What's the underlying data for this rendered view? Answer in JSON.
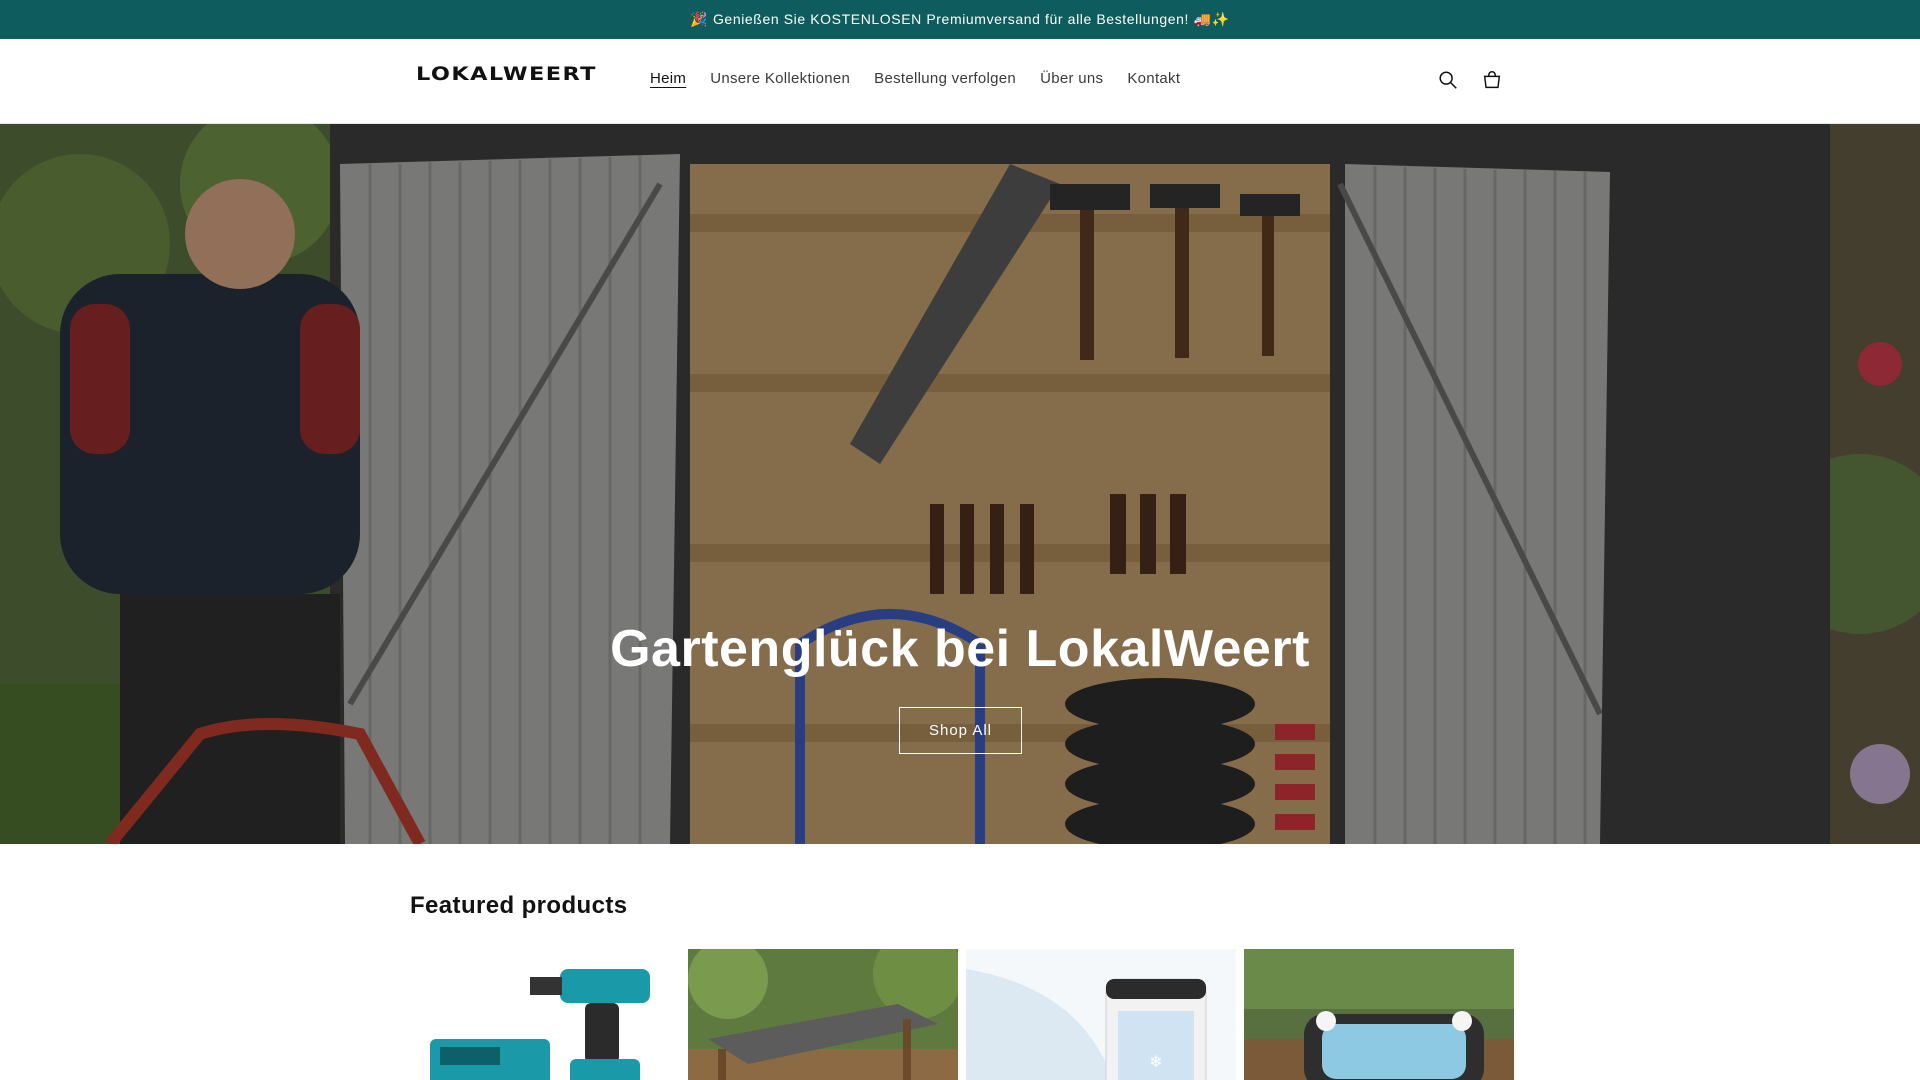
{
  "announcement": {
    "text": "🎉 Genießen Sie KOSTENLOSEN Premiumversand für alle Bestellungen! 🚚✨"
  },
  "header": {
    "logo": "LOKALWEERT",
    "nav": [
      {
        "label": "Heim",
        "active": true
      },
      {
        "label": "Unsere Kollektionen",
        "active": false
      },
      {
        "label": "Bestellung verfolgen",
        "active": false
      },
      {
        "label": "Über uns",
        "active": false
      },
      {
        "label": "Kontakt",
        "active": false
      }
    ],
    "icons": [
      "search-icon",
      "cart-icon"
    ]
  },
  "hero": {
    "title": "Gartenglück bei LokalWeert",
    "button_label": "Shop All"
  },
  "featured": {
    "title": "Featured products",
    "products": [
      {
        "image": "cordless-drill-kit"
      },
      {
        "image": "garden-pergola-canopy"
      },
      {
        "image": "portable-air-cooler"
      },
      {
        "image": "inflatable-hot-tub"
      }
    ]
  },
  "colors": {
    "announcement_bg": "#0f5c5e",
    "text": "#121212",
    "accent_drill": "#1a9aa8"
  }
}
